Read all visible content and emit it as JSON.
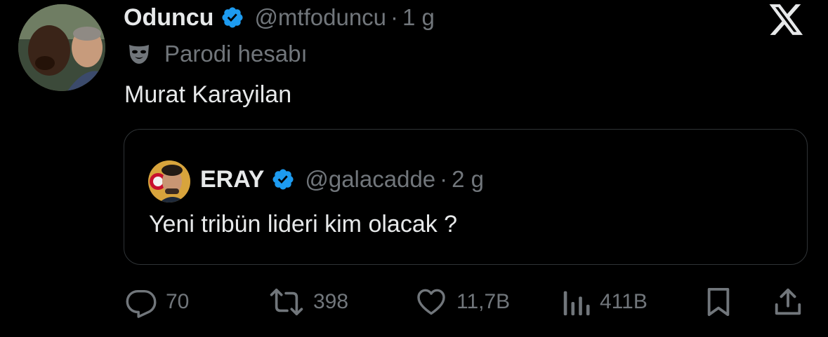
{
  "author": {
    "name": "Oduncu",
    "handle": "@mtfoduncu",
    "separator": "·",
    "time": "1 g",
    "badge_label": "Parodi hesabı"
  },
  "tweet": {
    "text": "Murat Karayilan"
  },
  "quoted": {
    "name": "ERAY",
    "handle": "@galacadde",
    "separator": "·",
    "time": "2 g",
    "text": "Yeni tribün lideri kim olacak ?"
  },
  "actions": {
    "replies": "70",
    "reposts": "398",
    "likes": "11,7B",
    "views": "411B"
  },
  "icons": {
    "platform_logo": "x-logo-icon",
    "verified": "verified-badge-icon",
    "parody": "parody-mask-icon",
    "reply": "reply-icon",
    "repost": "repost-icon",
    "like": "heart-icon",
    "views": "views-icon",
    "bookmark": "bookmark-icon",
    "share": "share-icon"
  },
  "colors": {
    "background": "#000000",
    "primary_text": "#e7e9ea",
    "secondary_text": "#71767b",
    "verified": "#1d9bf0",
    "border": "#2f3336"
  }
}
